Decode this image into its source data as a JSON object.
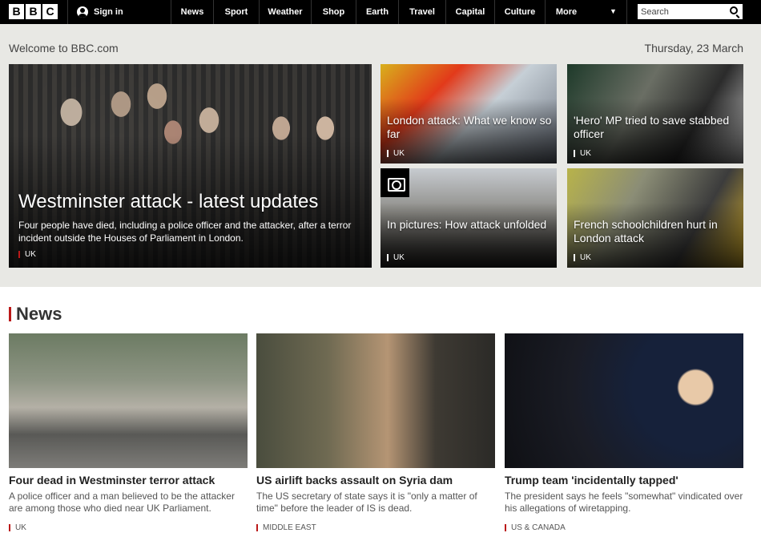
{
  "header": {
    "logo_letters": [
      "B",
      "B",
      "C"
    ],
    "sign_in": "Sign in",
    "nav": [
      "News",
      "Sport",
      "Weather",
      "Shop",
      "Earth",
      "Travel",
      "Capital",
      "Culture",
      "More"
    ],
    "search_placeholder": "Search"
  },
  "hero": {
    "welcome": "Welcome to BBC.com",
    "date": "Thursday, 23 March",
    "main": {
      "title": "Westminster attack - latest updates",
      "summary": "Four people have died, including a police officer and the attacker, after a terror incident outside the Houses of Parliament in London.",
      "tag": "UK"
    },
    "cards": [
      {
        "title": "London attack: What we know so far",
        "tag": "UK"
      },
      {
        "title": "'Hero' MP tried to save stabbed officer",
        "tag": "UK"
      },
      {
        "title": "In pictures: How attack unfolded",
        "tag": "UK"
      },
      {
        "title": "French schoolchildren hurt in London attack",
        "tag": "UK"
      }
    ]
  },
  "news": {
    "heading": "News",
    "stories": [
      {
        "title": "Four dead in Westminster terror attack",
        "summary": "A police officer and a man believed to be the attacker are among those who died near UK Parliament.",
        "tag": "UK"
      },
      {
        "title": "US airlift backs assault on Syria dam",
        "summary": "The US secretary of state says it is \"only a matter of time\" before the leader of IS is dead.",
        "tag": "MIDDLE EAST"
      },
      {
        "title": "Trump team 'incidentally tapped'",
        "summary": "The president says he feels \"somewhat\" vindicated over his allegations of wiretapping.",
        "tag": "US & CANADA"
      }
    ]
  },
  "colors": {
    "accent": "#bb1919",
    "topbar": "#000000",
    "hero_bg": "#e8e8e4"
  }
}
